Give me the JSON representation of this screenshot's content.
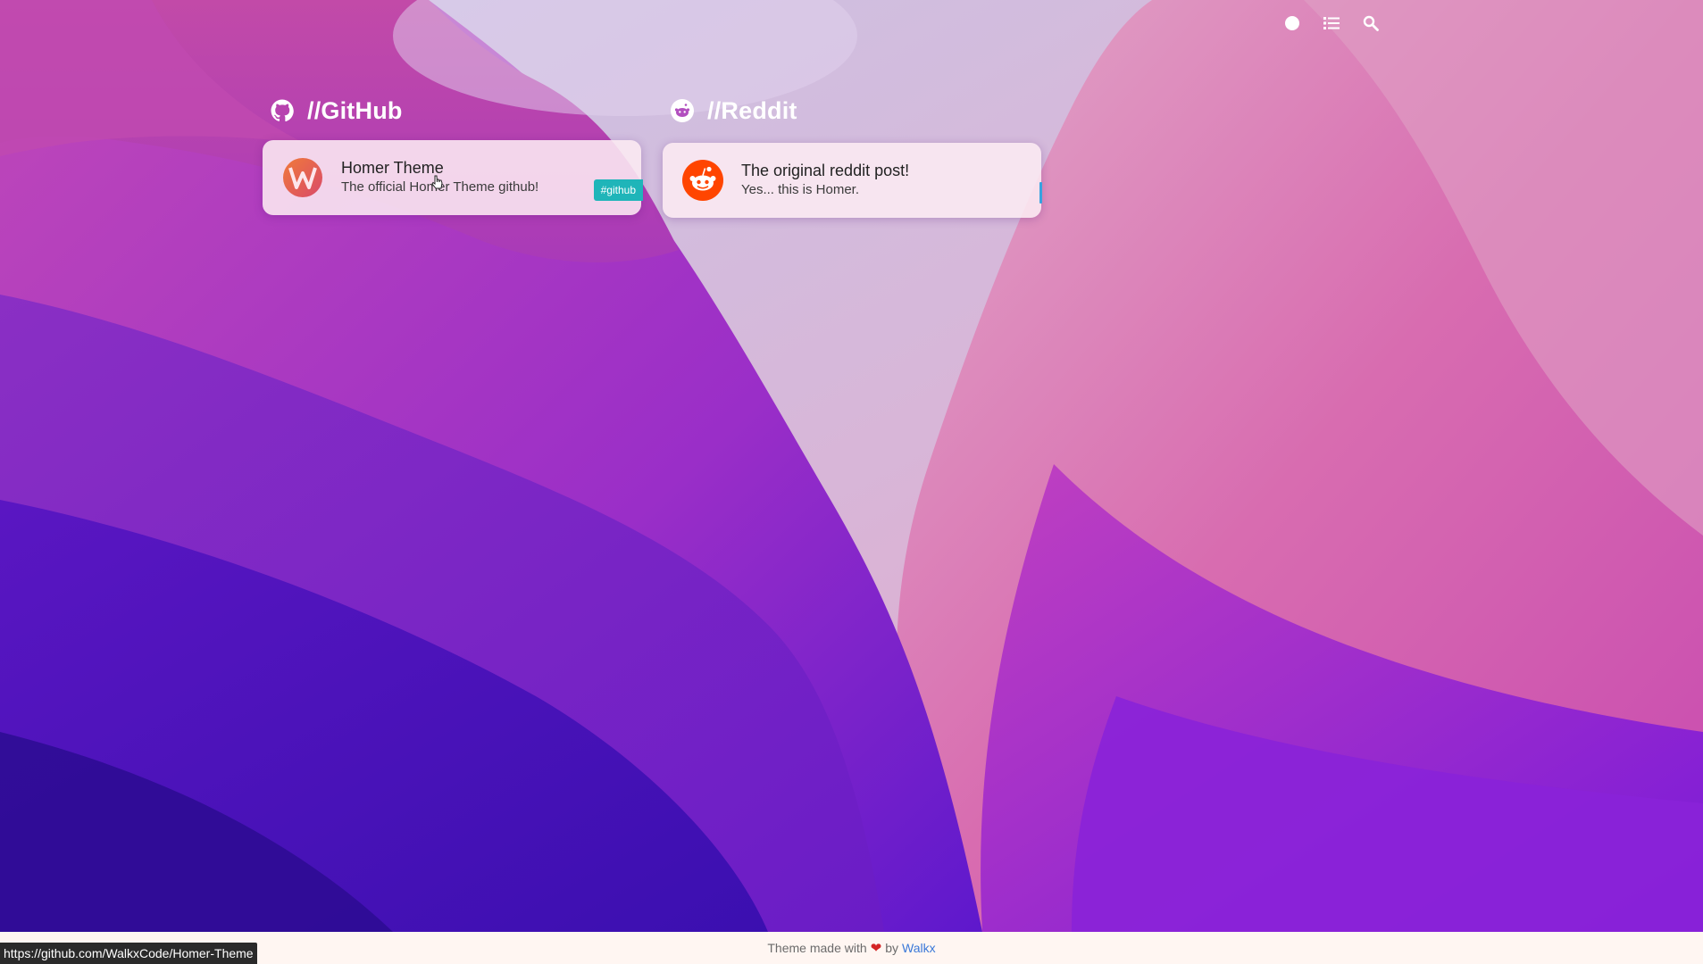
{
  "navbar": {
    "icons": [
      "dark-mode-dot-icon",
      "list-view-icon",
      "search-icon"
    ]
  },
  "groups": [
    {
      "title": "//GitHub",
      "icon": "github-icon",
      "cards": [
        {
          "name": "Homer Theme",
          "subtitle": "The official Homer Theme github!",
          "tag": "#github",
          "logo": "walkx-logo-icon",
          "tag_color": "#1fb5b9"
        }
      ]
    },
    {
      "title": "//Reddit",
      "icon": "reddit-icon",
      "cards": [
        {
          "name": "The original reddit post!",
          "subtitle": "Yes... this is Homer.",
          "logo": "reddit-logo-icon"
        }
      ]
    }
  ],
  "footer": {
    "text_before": "Theme made with",
    "text_by": "by",
    "author_link": "Walkx",
    "heart_color": "#d42525"
  },
  "statusbar": {
    "url": "https://github.com/WalkxCode/Homer-Theme"
  }
}
